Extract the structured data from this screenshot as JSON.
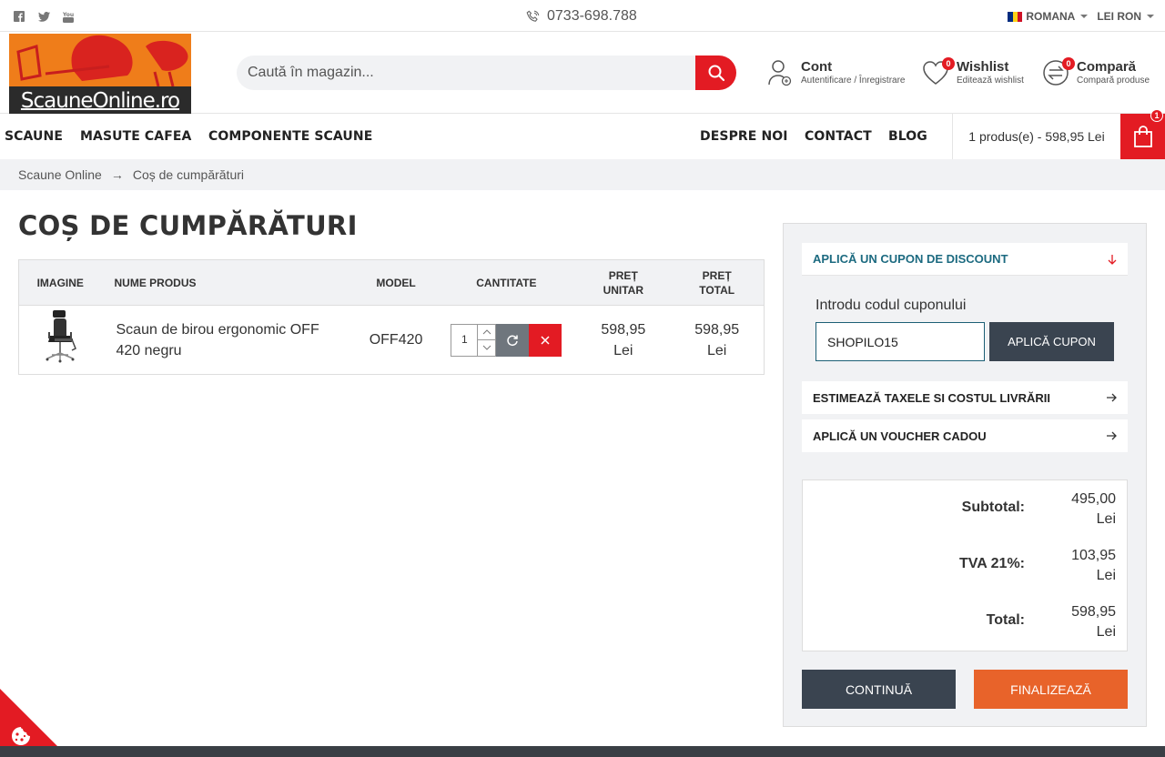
{
  "topbar": {
    "social": [
      "facebook-icon",
      "twitter-icon",
      "youtube-icon"
    ],
    "phone": "0733-698.788",
    "language": "ROMANA",
    "currency": "LEI RON"
  },
  "header": {
    "logo_text": "ScauneOnline.ro",
    "search_placeholder": "Caută în magazin...",
    "account_title": "Cont",
    "account_sub": "Autentificare / Înregistrare",
    "wishlist_title": "Wishlist",
    "wishlist_sub": "Editează wishlist",
    "wishlist_count": "0",
    "compare_title": "Compară",
    "compare_sub": "Compară produse",
    "compare_count": "0"
  },
  "nav": {
    "left": [
      "SCAUNE",
      "MASUTE CAFEA",
      "COMPONENTE SCAUNE"
    ],
    "right": [
      "DESPRE NOI",
      "CONTACT",
      "BLOG"
    ],
    "cart_summary": "1 produs(e) - 598,95 Lei",
    "cart_count": "1"
  },
  "breadcrumb": [
    "Scaune Online",
    "Coș de cumpărături"
  ],
  "page_title": "COȘ DE CUMPĂRĂTURI",
  "table": {
    "headers": {
      "image": "IMAGINE",
      "name": "NUME PRODUS",
      "model": "MODEL",
      "qty": "CANTITATE",
      "unit_1": "PREȚ",
      "unit_2": "UNITAR",
      "total_1": "PREȚ",
      "total_2": "TOTAL"
    },
    "rows": [
      {
        "name": "Scaun de birou ergonomic OFF 420 negru",
        "model": "OFF420",
        "qty": "1",
        "unit_price_1": "598,95",
        "unit_price_2": "Lei",
        "total_price_1": "598,95",
        "total_price_2": "Lei"
      }
    ]
  },
  "side": {
    "coupon_title": "APLICĂ UN CUPON DE DISCOUNT",
    "coupon_label": "Introdu codul cuponului",
    "coupon_value": "SHOPILO15",
    "coupon_button": "APLICĂ CUPON",
    "shipping_title": "ESTIMEAZĂ TAXELE SI COSTUL LIVRĂRII",
    "voucher_title": "APLICĂ UN VOUCHER CADOU",
    "totals": [
      {
        "label": "Subtotal:",
        "amount": "495,00",
        "currency": "Lei"
      },
      {
        "label": "TVA 21%:",
        "amount": "103,95",
        "currency": "Lei"
      },
      {
        "label": "Total:",
        "amount": "598,95",
        "currency": "Lei"
      }
    ],
    "continue_button": "CONTINUĂ",
    "checkout_button": "FINALIZEAZĂ"
  },
  "colors": {
    "accent_red": "#e31b23",
    "dark_button": "#3a4450",
    "orange_button": "#e8632a",
    "link_teal": "#1c5f75"
  }
}
